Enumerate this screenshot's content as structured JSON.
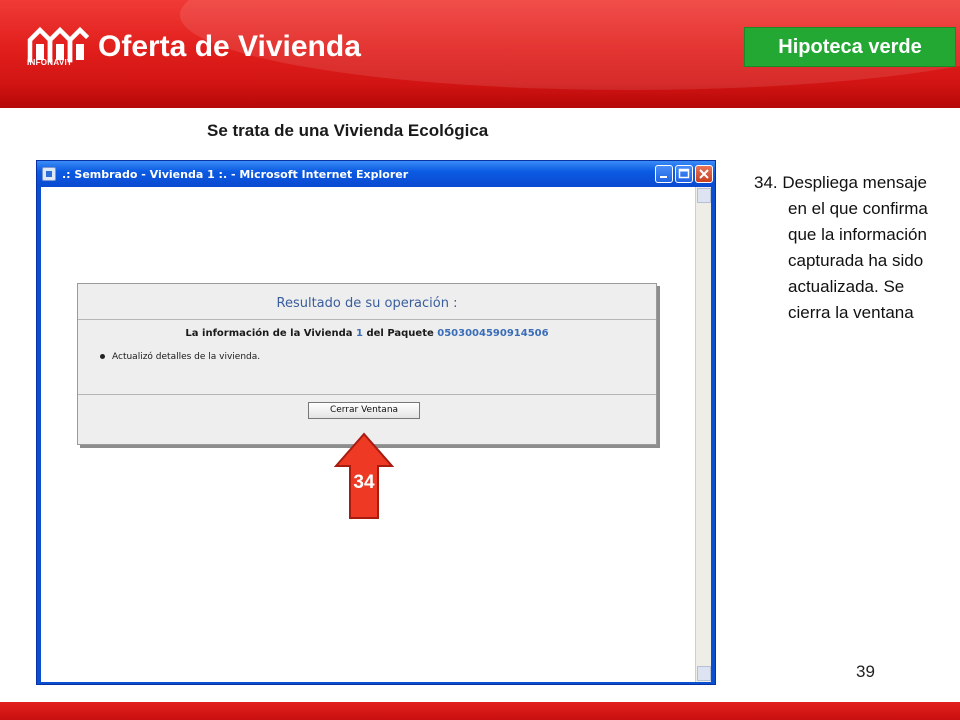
{
  "header": {
    "app_title": "Oferta de Vivienda",
    "logo_caption": "INFONAVIT",
    "badge": "Hipoteca verde",
    "brand_red": "#e11f1c",
    "badge_green": "#22a833"
  },
  "subtitle": "Se trata de una Vivienda Ecológica",
  "ie_window": {
    "title": ".: Sembrado - Vivienda 1 :. - Microsoft Internet Explorer",
    "controls": [
      "minimize-icon",
      "maximize-icon",
      "close-icon"
    ],
    "result_panel": {
      "heading": "Resultado de su operación :",
      "info_prefix": "La información de la Vivienda",
      "vivienda_number": "1",
      "info_middle": "del Paquete",
      "paquete_number": "0503004590914506",
      "bullet": "Actualizó detalles de la vivienda.",
      "close_button": "Cerrar Ventana"
    }
  },
  "callout": {
    "label": "34",
    "color": "#ee3a24"
  },
  "instruction": "34. Despliega mensaje en el que confirma que la información capturada ha sido actualizada. Se cierra la ventana",
  "page_number": "39"
}
